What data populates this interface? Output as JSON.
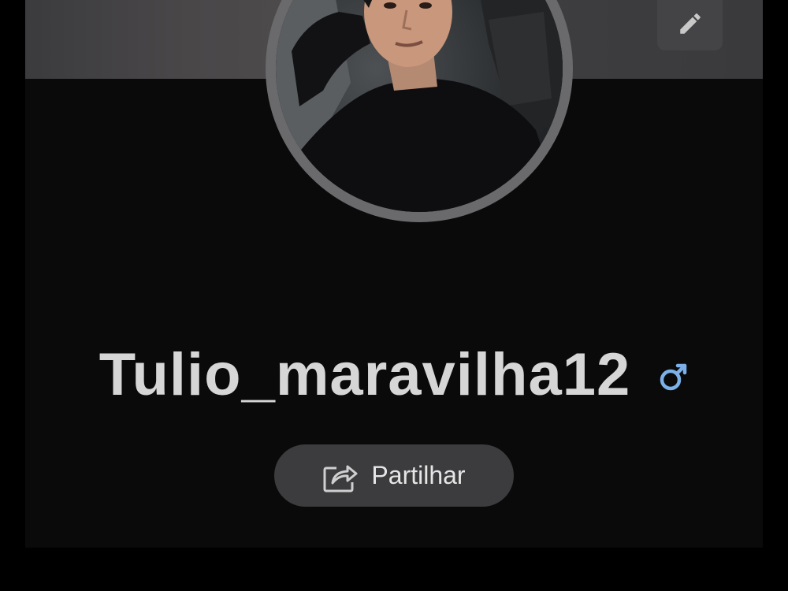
{
  "profile": {
    "username": "Tulio_maravilha12",
    "gender_icon": "male-symbol-icon",
    "gender_color": "#7bb0e8",
    "avatar_alt": "Foto de perfil"
  },
  "actions": {
    "edit_icon": "pencil-icon",
    "share_icon": "share-arrow-icon",
    "share_label": "Partilhar"
  },
  "colors": {
    "background": "#000000",
    "card": "#0a0a0b",
    "button": "#3c3c3e",
    "text": "#d6d6d6"
  }
}
